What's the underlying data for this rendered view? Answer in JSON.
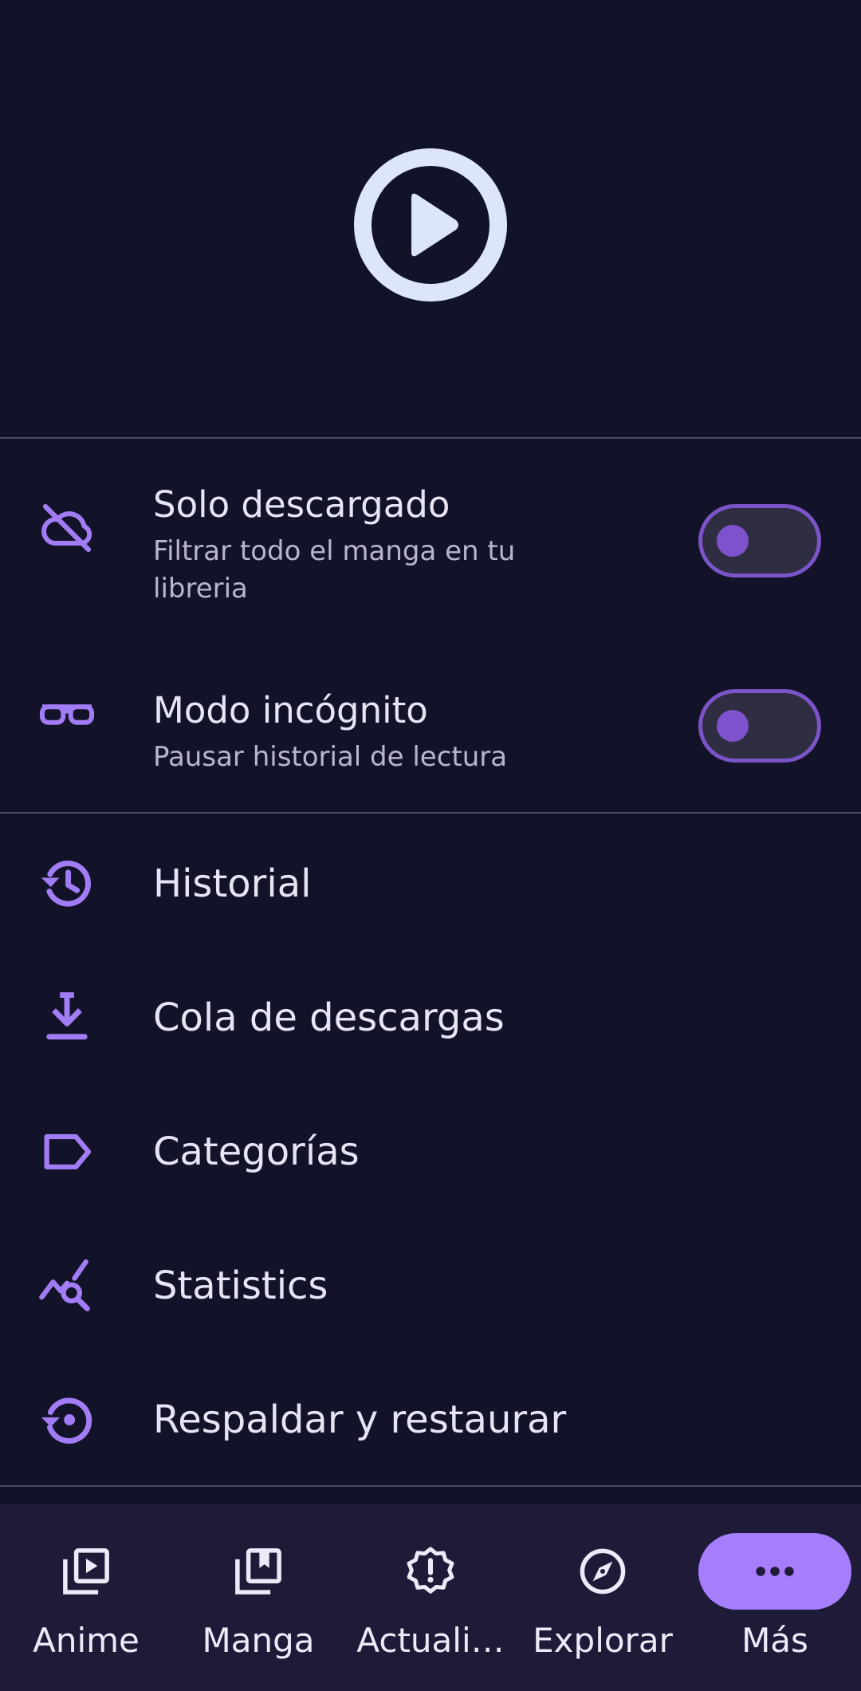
{
  "colors": {
    "background": "#121229",
    "accent": "#A67DFA",
    "icon_accent": "#A27CF4",
    "text_primary": "#E6E4F5",
    "text_secondary": "#B8B6CC",
    "nav_background": "#1D1B38",
    "logo": "#DCE5FB"
  },
  "hero": {
    "logo_icon": "play-circle-icon"
  },
  "toggles": [
    {
      "icon": "cloud-off-icon",
      "title": "Solo descargado",
      "subtitle": "Filtrar todo el manga en tu libreria",
      "enabled": false
    },
    {
      "icon": "glasses-icon",
      "title": "Modo incógnito",
      "subtitle": "Pausar historial de lectura",
      "enabled": false
    }
  ],
  "menu": [
    {
      "icon": "history-icon",
      "label": "Historial"
    },
    {
      "icon": "download-icon",
      "label": "Cola de descargas"
    },
    {
      "icon": "label-icon",
      "label": "Categorías"
    },
    {
      "icon": "query-stats-icon",
      "label": "Statistics"
    },
    {
      "icon": "settings-backup-restore-icon",
      "label": "Respaldar y restaurar"
    }
  ],
  "bottom_nav": [
    {
      "icon": "video-library-icon",
      "label": "Anime",
      "active": false
    },
    {
      "icon": "collections-bookmark-icon",
      "label": "Manga",
      "active": false
    },
    {
      "icon": "new-releases-icon",
      "label": "Actuali…",
      "active": false
    },
    {
      "icon": "explore-icon",
      "label": "Explorar",
      "active": false
    },
    {
      "icon": "more-horiz-icon",
      "label": "Más",
      "active": true
    }
  ]
}
